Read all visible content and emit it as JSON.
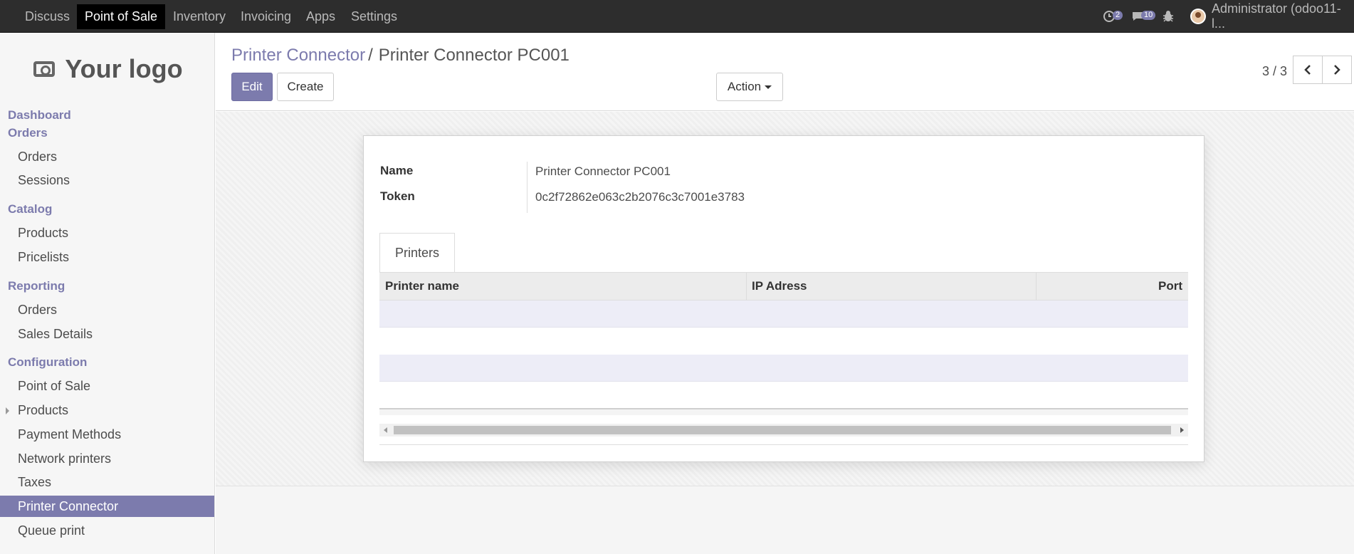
{
  "topnav": {
    "menus": [
      "Discuss",
      "Point of Sale",
      "Inventory",
      "Invoicing",
      "Apps",
      "Settings"
    ],
    "activity_badge": "2",
    "messages_badge": "10",
    "user": "Administrator (odoo11-l..."
  },
  "sidebar": {
    "logo_text": "Your logo",
    "sections": {
      "dashboard": "Dashboard",
      "orders": "Orders",
      "catalog": "Catalog",
      "reporting": "Reporting",
      "configuration": "Configuration"
    },
    "items": {
      "orders": "Orders",
      "sessions": "Sessions",
      "products": "Products",
      "pricelists": "Pricelists",
      "reporting_orders": "Orders",
      "sales_details": "Sales Details",
      "point_of_sale": "Point of Sale",
      "config_products": "Products",
      "payment_methods": "Payment Methods",
      "network_printers": "Network printers",
      "taxes": "Taxes",
      "printer_connector": "Printer Connector",
      "queue_print": "Queue print"
    }
  },
  "control": {
    "breadcrumb_parent": "Printer Connector",
    "breadcrumb_sep": "/",
    "breadcrumb_current": "Printer Connector PC001",
    "edit_label": "Edit",
    "create_label": "Create",
    "action_label": "Action",
    "pager": "3 / 3"
  },
  "form": {
    "name_label": "Name",
    "name_value": "Printer Connector PC001",
    "token_label": "Token",
    "token_value": "0c2f72862e063c2b2076c3c7001e3783",
    "tab_label": "Printers",
    "columns": [
      "Printer name",
      "IP Adress",
      "Port"
    ]
  },
  "colors": {
    "accent": "#7c7bad",
    "navbar": "#2d2d2d"
  }
}
